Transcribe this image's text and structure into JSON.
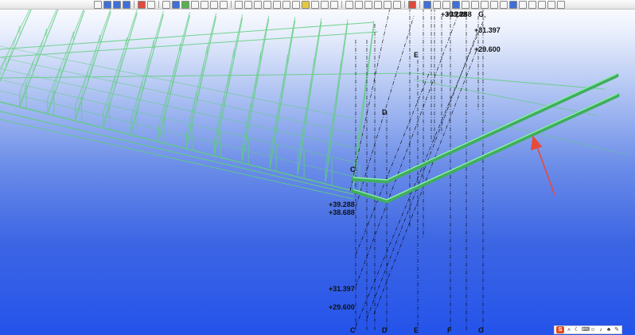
{
  "toolbar": {
    "view_name": "standard",
    "icons": [
      "snap-icon",
      "new-icon",
      "open-icon",
      "save-icon",
      "undo-icon",
      "redo-icon",
      "print-icon",
      "model-icon",
      "zoom-icon",
      "pan-icon",
      "rotate-icon",
      "select-icon",
      "cursor-icon",
      "mirror-icon",
      "grid-icon",
      "view-icon",
      "properties-icon",
      "layer-icon"
    ]
  },
  "gridlines": {
    "bottom_labels": [
      "C",
      "D",
      "E",
      "F",
      "G"
    ],
    "upper_labels": [
      "C",
      "D",
      "E",
      "G"
    ]
  },
  "elevations": {
    "upper_right": [
      "+39.288",
      "+31.397",
      "+29.600"
    ],
    "mid_left": [
      "+39.288",
      "+38.688"
    ],
    "lower_left": [
      "+31.397",
      "+29.600"
    ]
  },
  "annotation": {
    "color": "#e84a3a",
    "target": "new-beams"
  },
  "structure_color": "#5fce7f",
  "tray": {
    "ime_label": "S",
    "icons": [
      "ime-s-icon",
      "punctuation-icon",
      "moon-icon",
      "keyboard-icon",
      "user-icon",
      "mic-icon",
      "shirt-icon",
      "wrench-icon"
    ]
  }
}
